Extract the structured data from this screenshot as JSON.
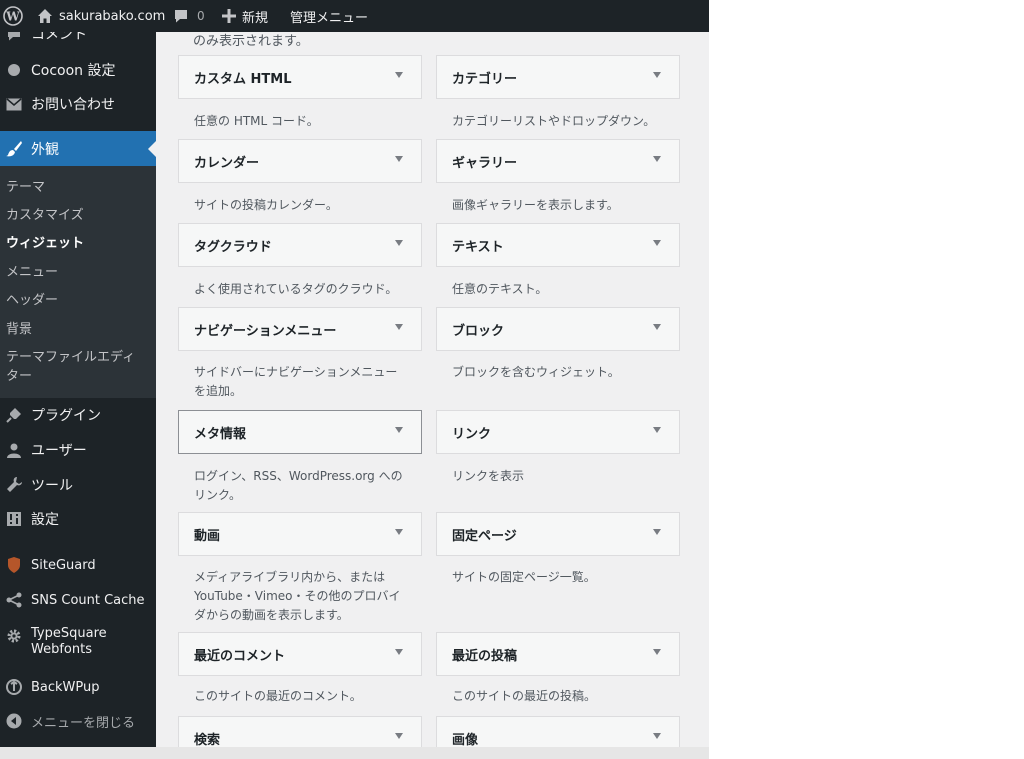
{
  "adminbar": {
    "site_name": "sakurabako.com",
    "comment_count": "0",
    "new_label": "新規",
    "manage_label": "管理メニュー"
  },
  "sidebar": {
    "comments": "コメント",
    "cocoon": "Cocoon 設定",
    "contact": "お問い合わせ",
    "appearance": "外観",
    "submenu": [
      "テーマ",
      "カスタマイズ",
      "ウィジェット",
      "メニュー",
      "ヘッダー",
      "背景",
      "テーマファイルエディター"
    ],
    "plugins": "プラグイン",
    "users": "ユーザー",
    "tools": "ツール",
    "settings": "設定",
    "siteguard": "SiteGuard",
    "sns": "SNS Count Cache",
    "typesquare": "TypeSquare Webfonts",
    "backwpup": "BackWPup",
    "collapse": "メニューを閉じる"
  },
  "content": {
    "top_desc": "のみ表示されます。",
    "widgets": [
      {
        "title": "カスタム HTML",
        "desc": "任意の HTML コード。"
      },
      {
        "title": "カテゴリー",
        "desc": "カテゴリーリストやドロップダウン。"
      },
      {
        "title": "カレンダー",
        "desc": "サイトの投稿カレンダー。"
      },
      {
        "title": "ギャラリー",
        "desc": "画像ギャラリーを表示します。"
      },
      {
        "title": "タグクラウド",
        "desc": "よく使用されているタグのクラウド。"
      },
      {
        "title": "テキスト",
        "desc": "任意のテキスト。"
      },
      {
        "title": "ナビゲーションメニュー",
        "desc": "サイドバーにナビゲーションメニューを追加。"
      },
      {
        "title": "ブロック",
        "desc": "ブロックを含むウィジェット。"
      },
      {
        "title": "メタ情報",
        "desc": "ログイン、RSS、WordPress.org へのリンク。"
      },
      {
        "title": "リンク",
        "desc": "リンクを表示"
      },
      {
        "title": "動画",
        "desc": "メディアライブラリ内から、または YouTube・Vimeo・その他のプロバイダからの動画を表示します。"
      },
      {
        "title": "固定ページ",
        "desc": "サイトの固定ページ一覧。"
      },
      {
        "title": "最近のコメント",
        "desc": "このサイトの最近のコメント。"
      },
      {
        "title": "最近の投稿",
        "desc": "このサイトの最近の投稿。"
      },
      {
        "title": "検索",
        "desc": ""
      },
      {
        "title": "画像",
        "desc": ""
      }
    ]
  },
  "colors": {
    "admin_bg": "#1d2327",
    "accent": "#2271b1",
    "submenu_bg": "#2c3338",
    "content_bg": "#f0f0f1"
  }
}
